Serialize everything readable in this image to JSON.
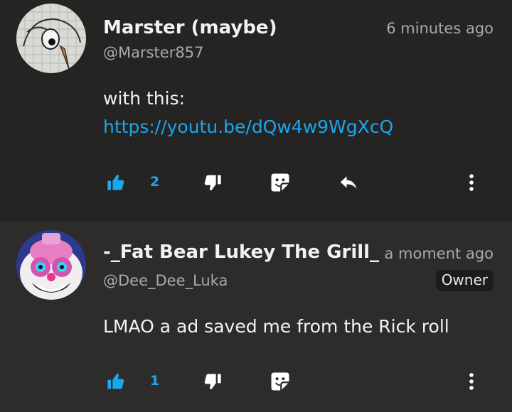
{
  "comments": [
    {
      "name": "Marster (maybe)",
      "handle": "@Marster857",
      "time": "6 minutes ago",
      "text": "with this:",
      "link": "https://youtu.be/dQw4w9WgXcQ",
      "likes": "2",
      "avatar_icon": "sketch-bird-avatar"
    },
    {
      "name": "-_Fat Bear Lukey The Grill_",
      "handle": "@Dee_Dee_Luka",
      "time": "a moment ago",
      "badge": "Owner",
      "text": "LMAO a ad saved me from the Rick roll",
      "likes": "1",
      "avatar_icon": "clown-bear-avatar"
    }
  ],
  "icons": {
    "like": "thumbs-up-icon",
    "dislike": "thumbs-down-icon",
    "sticker": "sticker-icon",
    "reply": "reply-icon",
    "more": "more-vertical-icon"
  },
  "colors": {
    "accent": "#1aa7ec",
    "background_top": "#262422",
    "background_bottom": "#2d2c2a"
  }
}
